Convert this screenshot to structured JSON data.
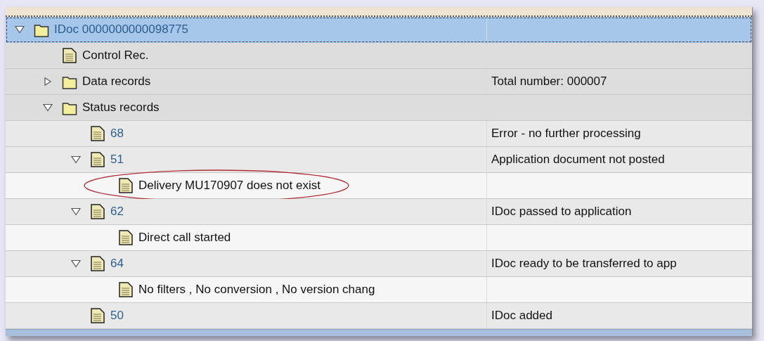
{
  "tree": [
    {
      "label": "IDoc 0000000000098775",
      "kind": "folder",
      "link": true,
      "selected": true,
      "expanded": true,
      "highlighted": false,
      "children": [
        {
          "label": "Control Rec.",
          "kind": "document",
          "link": false,
          "selected": false,
          "highlighted": false
        },
        {
          "label": "Data records",
          "kind": "folder",
          "link": false,
          "selected": false,
          "expanded": false,
          "highlighted": false,
          "description": "Total number: 000007"
        },
        {
          "label": "Status records",
          "kind": "folder",
          "link": false,
          "selected": false,
          "expanded": true,
          "highlighted": false,
          "children": [
            {
              "label": "68",
              "kind": "document",
              "link": true,
              "selected": false,
              "highlighted": false,
              "description": "Error - no further processing"
            },
            {
              "label": "51",
              "kind": "document",
              "link": true,
              "selected": false,
              "expanded": true,
              "highlighted": false,
              "description": "Application document not posted",
              "children": [
                {
                  "label": "Delivery MU170907 does not exist",
                  "kind": "document",
                  "link": false,
                  "selected": false,
                  "highlighted": true
                }
              ]
            },
            {
              "label": "62",
              "kind": "document",
              "link": true,
              "selected": false,
              "expanded": true,
              "highlighted": false,
              "description": "IDoc passed to application",
              "children": [
                {
                  "label": "Direct call started",
                  "kind": "document",
                  "link": false,
                  "selected": false,
                  "highlighted": false
                }
              ]
            },
            {
              "label": "64",
              "kind": "document",
              "link": true,
              "selected": false,
              "expanded": true,
              "highlighted": false,
              "description": "IDoc ready to be transferred to app",
              "children": [
                {
                  "label": "No filters , No conversion , No version chang",
                  "kind": "document",
                  "link": false,
                  "selected": false,
                  "highlighted": false
                }
              ]
            },
            {
              "label": "50",
              "kind": "document",
              "link": true,
              "selected": false,
              "highlighted": false,
              "description": "IDoc added"
            }
          ]
        }
      ]
    }
  ]
}
